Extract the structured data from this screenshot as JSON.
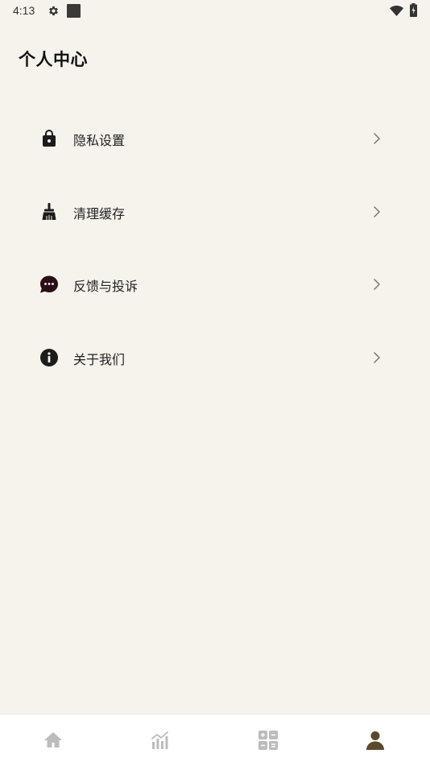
{
  "status_bar": {
    "time": "4:13",
    "icons": [
      "gear-icon",
      "notification-square-icon",
      "wifi-icon",
      "battery-icon"
    ]
  },
  "page": {
    "title": "个人中心"
  },
  "menu": {
    "items": [
      {
        "label": "隐私设置",
        "icon": "lock-icon"
      },
      {
        "label": "清理缓存",
        "icon": "broom-icon"
      },
      {
        "label": "反馈与投诉",
        "icon": "chat-bubble-icon"
      },
      {
        "label": "关于我们",
        "icon": "info-icon"
      }
    ],
    "chevron_icon": "chevron-right-icon"
  },
  "bottom_nav": {
    "items": [
      {
        "icon": "home-icon",
        "active": false
      },
      {
        "icon": "chart-icon",
        "active": false
      },
      {
        "icon": "calculator-icon",
        "active": false
      },
      {
        "icon": "person-icon",
        "active": true
      }
    ]
  },
  "colors": {
    "background": "#f6f2ec",
    "nav_background": "#ffffff",
    "icon_dark": "#1c1c1c",
    "nav_inactive": "#bcbcbc",
    "nav_active": "#5b4a2e",
    "chevron": "#777777"
  }
}
